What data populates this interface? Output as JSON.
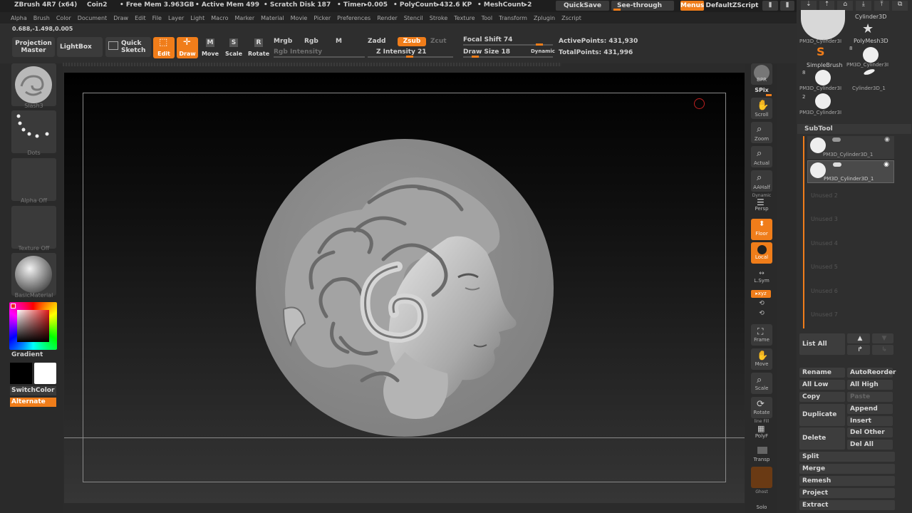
{
  "titlebar": {
    "app": "ZBrush 4R7 (x64)",
    "doc": "Coin2",
    "free_mem": "• Free Mem 3.963GB",
    "active_mem": "• Active Mem 499",
    "scratch": "• Scratch Disk 187",
    "timer": "• Timer▸0.005",
    "polycount": "• PolyCount▸432.6 KP",
    "meshcount": "• MeshCount▸2",
    "quicksave": "QuickSave",
    "see_through": "See-through",
    "see_through_value": "0",
    "menus": "Menus",
    "script": "DefaultZScript"
  },
  "menubar": [
    "Alpha",
    "Brush",
    "Color",
    "Document",
    "Draw",
    "Edit",
    "File",
    "Layer",
    "Light",
    "Macro",
    "Marker",
    "Material",
    "Movie",
    "Picker",
    "Preferences",
    "Render",
    "Stencil",
    "Stroke",
    "Texture",
    "Tool",
    "Transform",
    "Zplugin",
    "Zscript"
  ],
  "coords": "0.688,-1.498,0.005",
  "toolbar": {
    "projection_master": "Projection Master",
    "lightbox": "LightBox",
    "quick_sketch": "Quick Sketch",
    "edit": "Edit",
    "draw": "Draw",
    "move": "Move",
    "scale": "Scale",
    "rotate": "Rotate",
    "mrgb": "Mrgb",
    "rgb": "Rgb",
    "m": "M",
    "rgb_intensity": "Rgb Intensity",
    "zadd": "Zadd",
    "zsub": "Zsub",
    "zcut": "Zcut",
    "z_intensity": "Z Intensity 21",
    "focal_shift": "Focal Shift 74",
    "draw_size": "Draw Size 18",
    "dynamic": "Dynamic",
    "active_points": "ActivePoints: 431,930",
    "total_points": "TotalPoints: 431,996"
  },
  "left_shelf": {
    "brush": "Slash3",
    "stroke": "Dots",
    "alpha": "Alpha Off",
    "texture": "Texture Off",
    "material": "BasicMaterial",
    "gradient": "Gradient",
    "switch_color": "SwitchColor",
    "alternate": "Alternate"
  },
  "right_shelf": {
    "bpr": "BPR",
    "spix": "SPix",
    "scroll": "Scroll",
    "zoom": "Zoom",
    "actual": "Actual",
    "aahalf": "AAHalf",
    "dynamic": "Dynamic",
    "persp": "Persp",
    "floor": "Floor",
    "local": "Local",
    "lsym": "L.Sym",
    "xyz": "▸xyz",
    "frame": "Frame",
    "move": "Move",
    "scale": "Scale",
    "rotate": "Rotate",
    "line_fill": "line Fill",
    "polyf": "PolyF",
    "transp": "Transp",
    "ghost": "Ghost",
    "solo": "Solo"
  },
  "tool_palette": {
    "items": [
      {
        "label": "PM3D_Cylinder3I"
      },
      {
        "label": "Cylinder3D"
      },
      {
        "label": "PolyMesh3D"
      },
      {
        "label": "SimpleBrush"
      },
      {
        "label": "PM3D_Cylinder3I"
      },
      {
        "label": "PM3D_Cylinder3I"
      },
      {
        "label": "Cylinder3D_1"
      },
      {
        "label": "PM3D_Cylinder3I"
      }
    ],
    "badges": [
      "8",
      "8",
      "2"
    ]
  },
  "subtool": {
    "title": "SubTool",
    "items": [
      "PM3D_Cylinder3D_1",
      "PM3D_Cylinder3D_1"
    ],
    "unused": [
      "Unused 2",
      "Unused 3",
      "Unused 4",
      "Unused 5",
      "Unused 6",
      "Unused 7"
    ],
    "list_all": "List All",
    "rename": "Rename",
    "auto_reorder": "AutoReorder",
    "all_low": "All Low",
    "all_high": "All High",
    "copy": "Copy",
    "paste": "Paste",
    "duplicate": "Duplicate",
    "append": "Append",
    "insert": "Insert",
    "delete": "Delete",
    "del_other": "Del Other",
    "del_all": "Del All",
    "split": "Split",
    "merge": "Merge",
    "remesh": "Remesh",
    "project": "Project",
    "extract": "Extract"
  },
  "colors": {
    "accent": "#f07d1a",
    "background": "#2b2b2b",
    "coin": "#8f8f8f"
  }
}
